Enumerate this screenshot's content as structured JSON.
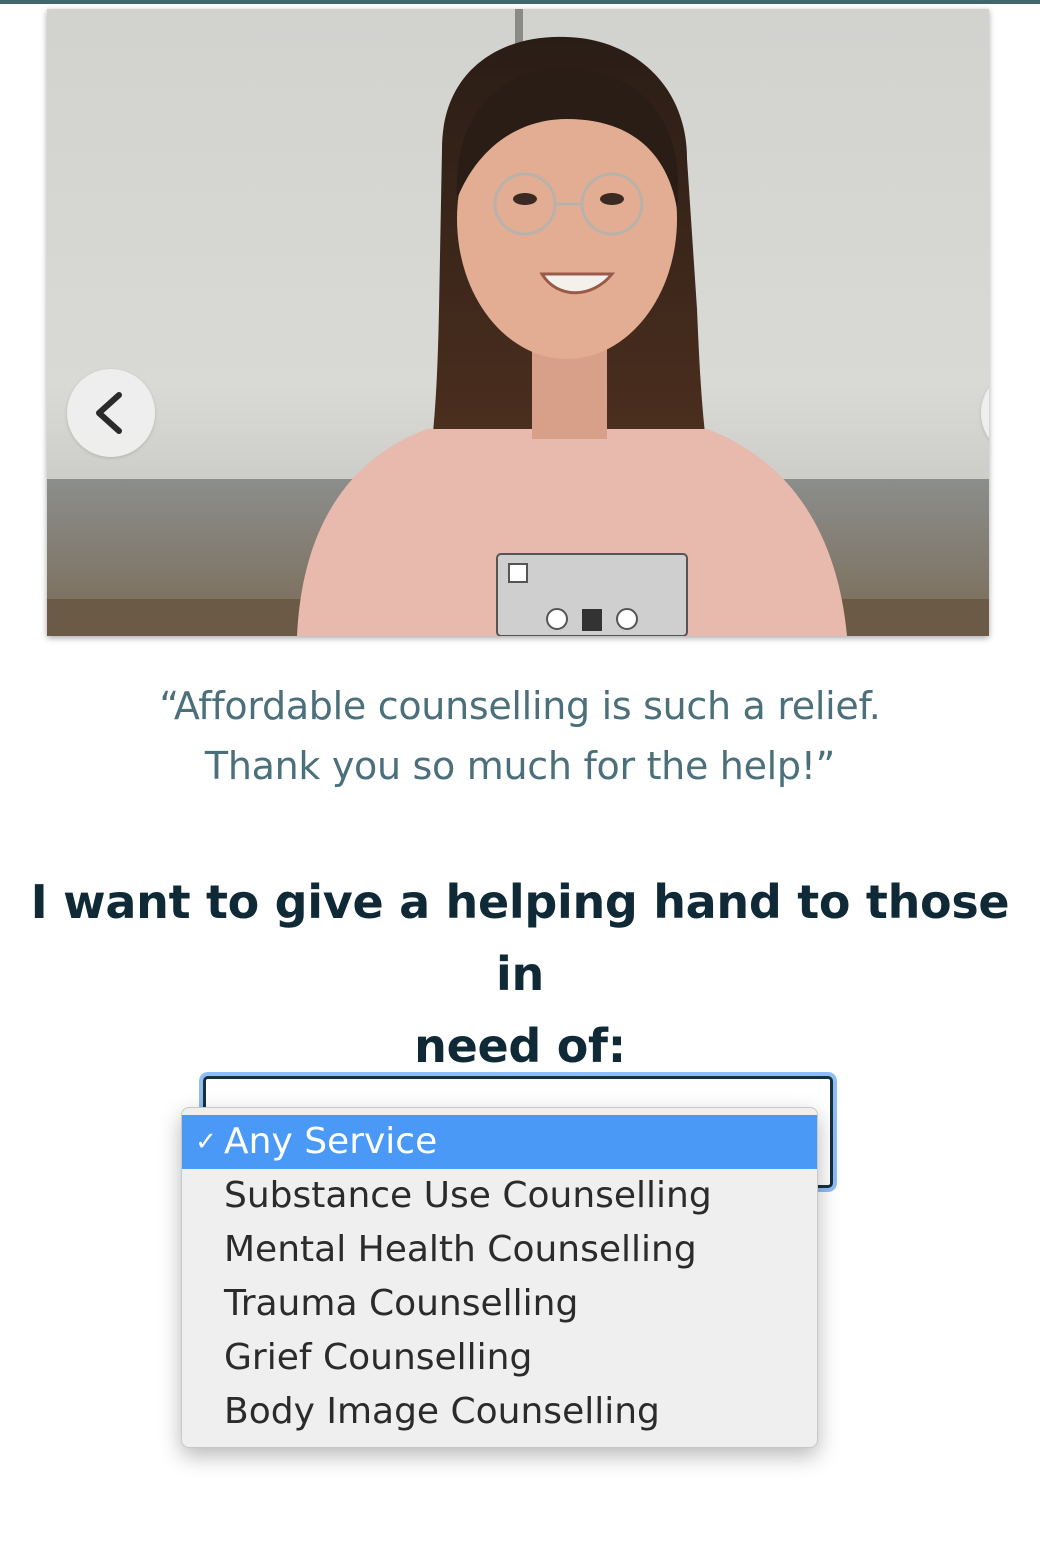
{
  "testimonial": {
    "quote_line1": "“Affordable counselling is such a relief.",
    "quote_line2": "Thank you so much for the help!”"
  },
  "carousel": {
    "prev_icon": "chevron-left-icon",
    "next_icon": "chevron-right-icon"
  },
  "cta": {
    "heading_line1": "I want to give a helping hand to those in",
    "heading_line2": "need of:"
  },
  "service_select": {
    "selected_value": "Any Service",
    "check_icon": "checkmark-icon",
    "check_glyph": "✓",
    "options": [
      "Any Service",
      "Substance Use Counselling",
      "Mental Health Counselling",
      "Trauma Counselling",
      "Grief Counselling",
      "Body Image Counselling"
    ]
  },
  "colors": {
    "accent_bar": "#40666f",
    "quote_text": "#4b6f7b",
    "heading_text": "#0f2a36",
    "option_highlight": "#4a99f7",
    "focus_ring": "#8fbdf5"
  }
}
